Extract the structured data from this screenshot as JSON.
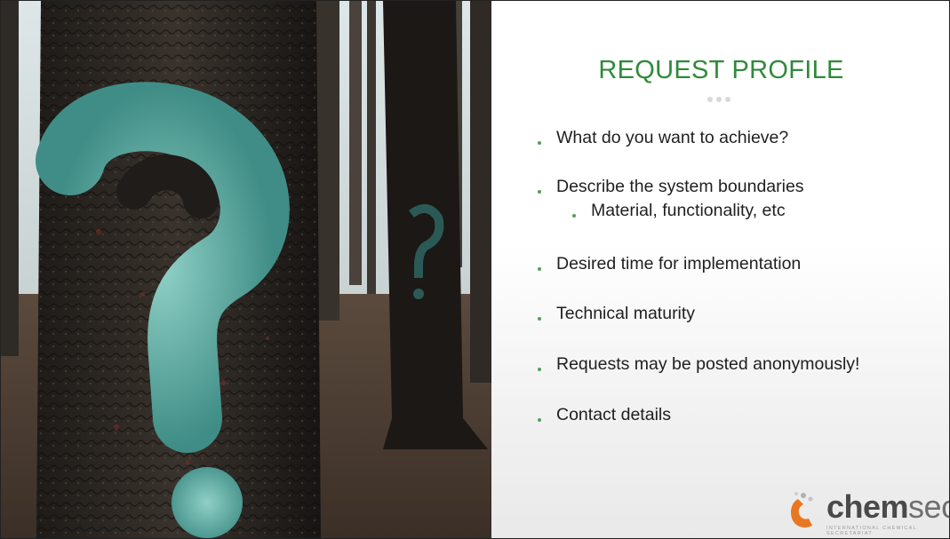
{
  "slide": {
    "title": "REQUEST PROFILE",
    "bullets": [
      {
        "text": "What do you want to achieve?",
        "level": 1
      },
      {
        "text": "Describe the system boundaries",
        "level": 1
      },
      {
        "text": "Material, functionality, etc",
        "level": 2
      },
      {
        "text": "Desired time for implementation",
        "level": 1
      },
      {
        "text": "Technical maturity",
        "level": 1
      },
      {
        "text": "Requests may be posted anonymously!",
        "level": 1
      },
      {
        "text": "Contact details",
        "level": 1
      }
    ]
  },
  "logo": {
    "word_bold": "chem",
    "word_light": "sec",
    "tagline": "INTERNATIONAL CHEMICAL SECRETARIAT"
  },
  "colors": {
    "title": "#2f8a3a",
    "bullet": "#4fa257",
    "logo_orange": "#e87722"
  },
  "image": {
    "description_icon": "question-mark-tree-photo"
  }
}
